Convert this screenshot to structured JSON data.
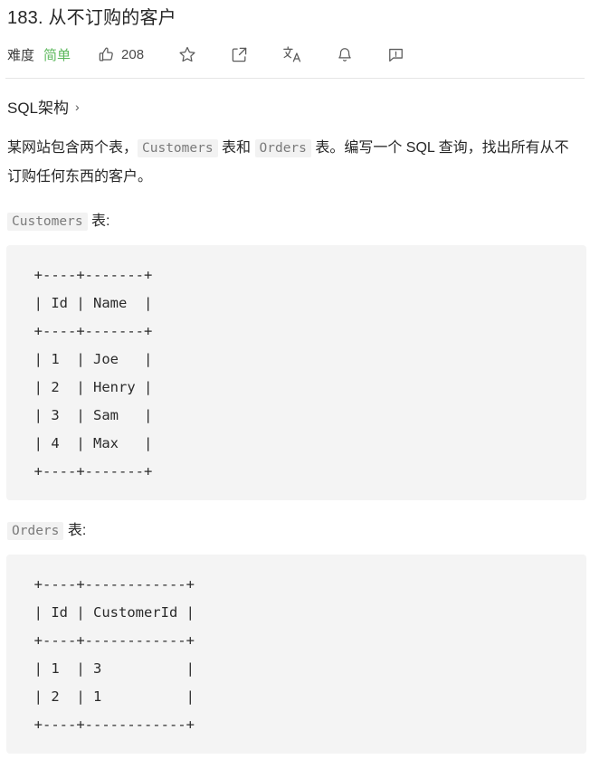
{
  "problem": {
    "title": "183. 从不订购的客户",
    "difficulty_label": "难度",
    "difficulty_value": "简单",
    "difficulty_color": "#5cb85c"
  },
  "toolbar": {
    "like_count": "208",
    "icons": [
      {
        "name": "thumbs-up-icon",
        "label": "点赞"
      },
      {
        "name": "star-icon",
        "label": "收藏"
      },
      {
        "name": "share-icon",
        "label": "分享"
      },
      {
        "name": "translate-icon",
        "label": "翻译"
      },
      {
        "name": "bell-icon",
        "label": "订阅"
      },
      {
        "name": "report-icon",
        "label": "反馈"
      }
    ]
  },
  "schema": {
    "link_text": "SQL架构",
    "chevron": "›"
  },
  "description": {
    "lead": "某网站包含两个表，",
    "code_customers": "Customers",
    "mid": " 表和 ",
    "code_orders": "Orders",
    "tail": " 表。编写一个 SQL 查询，找出所有从不订购任何东西的客户。"
  },
  "tables": [
    {
      "caption_code": "Customers",
      "caption_suffix": " 表:",
      "ascii": "  +----+-------+\n  | Id | Name  |\n  +----+-------+\n  | 1  | Joe   |\n  | 2  | Henry |\n  | 3  | Sam   |\n  | 4  | Max   |\n  +----+-------+",
      "columns": [
        "Id",
        "Name"
      ],
      "rows": [
        [
          "1",
          "Joe"
        ],
        [
          "2",
          "Henry"
        ],
        [
          "3",
          "Sam"
        ],
        [
          "4",
          "Max"
        ]
      ]
    },
    {
      "caption_code": "Orders",
      "caption_suffix": " 表:",
      "ascii": "  +----+------------+\n  | Id | CustomerId |\n  +----+------------+\n  | 1  | 3          |\n  | 2  | 1          |\n  +----+------------+",
      "columns": [
        "Id",
        "CustomerId"
      ],
      "rows": [
        [
          "1",
          "3"
        ],
        [
          "2",
          "1"
        ]
      ]
    }
  ]
}
